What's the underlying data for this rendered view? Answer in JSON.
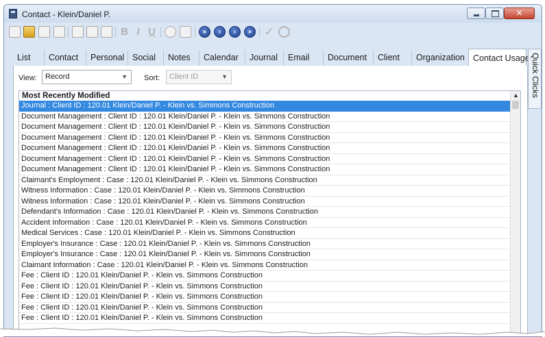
{
  "window": {
    "title": "Contact - Klein/Daniel P.",
    "close_glyph": "✕"
  },
  "toolbar": {
    "icons": [
      "new-document-icon",
      "open-folder-icon",
      "save-icon",
      "attach-icon",
      "cut-icon",
      "copy-icon",
      "paste-icon",
      "bold-icon",
      "italic-icon",
      "underline-icon",
      "delete-icon",
      "clipboard-icon",
      "first-record-icon",
      "previous-record-icon",
      "next-record-icon",
      "last-record-icon",
      "check-icon",
      "cancel-icon"
    ],
    "bold": "B",
    "italic": "I",
    "underline": "U",
    "first": "«",
    "previous": "‹",
    "next": "›",
    "last": "»",
    "check": "✓"
  },
  "tabs": [
    "List",
    "Contact",
    "Personal",
    "Social",
    "Notes",
    "Calendar",
    "Journal",
    "Email",
    "Document",
    "Client",
    "Organization",
    "Contact Usage"
  ],
  "active_tab": "Contact Usage",
  "side_tab": "Quick Clicks",
  "filters": {
    "view_label": "View:",
    "view_value": "Record",
    "sort_label": "Sort:",
    "sort_value": "Client ID"
  },
  "list": {
    "header": "Most Recently Modified",
    "selected_index": 0,
    "rows": [
      "Journal : Client ID : 120.01 Klein/Daniel P. - Klein vs. Simmons Construction",
      "Document Management : Client ID : 120.01 Klein/Daniel P. - Klein vs. Simmons Construction",
      "Document Management : Client ID : 120.01 Klein/Daniel P. - Klein vs. Simmons Construction",
      "Document Management : Client ID : 120.01 Klein/Daniel P. - Klein vs. Simmons Construction",
      "Document Management : Client ID : 120.01 Klein/Daniel P. - Klein vs. Simmons Construction",
      "Document Management : Client ID : 120.01 Klein/Daniel P. - Klein vs. Simmons Construction",
      "Document Management : Client ID : 120.01 Klein/Daniel P. - Klein vs. Simmons Construction",
      "Claimant's Employment : Case : 120.01 Klein/Daniel P. - Klein vs. Simmons Construction",
      "Witness Information : Case : 120.01 Klein/Daniel P. - Klein vs. Simmons Construction",
      "Witness Information : Case : 120.01 Klein/Daniel P. - Klein vs. Simmons Construction",
      "Defendant's Information : Case : 120.01 Klein/Daniel P. - Klein vs. Simmons Construction",
      "Accident Information : Case : 120.01 Klein/Daniel P. - Klein vs. Simmons Construction",
      "Medical Services : Case : 120.01 Klein/Daniel P. - Klein vs. Simmons Construction",
      "Employer's Insurance : Case : 120.01 Klein/Daniel P. - Klein vs. Simmons Construction",
      "Employer's Insurance : Case : 120.01 Klein/Daniel P. - Klein vs. Simmons Construction",
      "Claimant Information : Case : 120.01 Klein/Daniel P. - Klein vs. Simmons Construction",
      "Fee : Client ID : 120.01 Klein/Daniel P. - Klein vs. Simmons Construction",
      "Fee : Client ID : 120.01 Klein/Daniel P. - Klein vs. Simmons Construction",
      "Fee : Client ID : 120.01 Klein/Daniel P. - Klein vs. Simmons Construction",
      "Fee : Client ID : 120.01 Klein/Daniel P. - Klein vs. Simmons Construction",
      "Fee : Client ID : 120.01 Klein/Daniel P. - Klein vs. Simmons Construction"
    ]
  },
  "colors": {
    "selection": "#3388e0",
    "window_frame": "#dbe6f4"
  }
}
